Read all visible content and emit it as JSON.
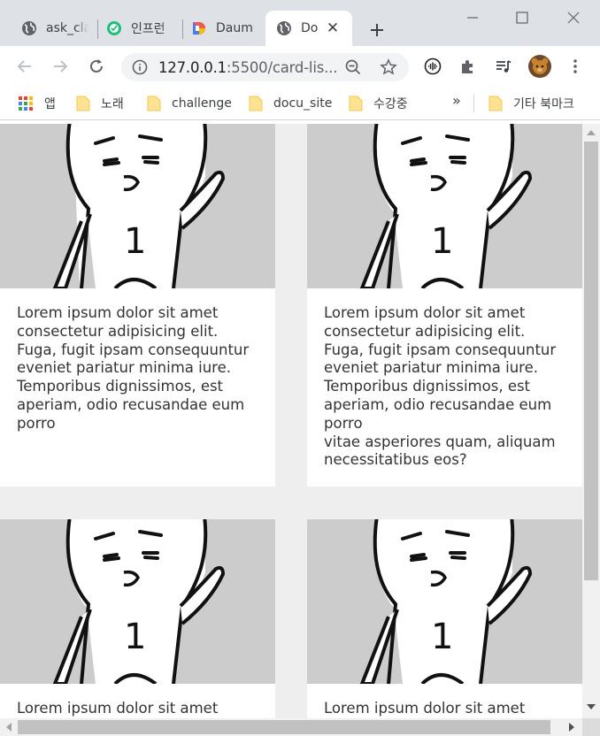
{
  "tabs": [
    {
      "title": "ask_class",
      "icon": "globe-icon",
      "active": false
    },
    {
      "title": "인프런",
      "icon": "inflearn-icon",
      "active": false
    },
    {
      "title": "Daum",
      "icon": "daum-icon",
      "active": false
    },
    {
      "title": "Document",
      "icon": "globe-icon",
      "active": true
    }
  ],
  "toolbar": {
    "url_host": "127.0.0.1",
    "url_rest": ":5500/card-lis..."
  },
  "bookmarks": {
    "apps_label": "앱",
    "items": [
      "노래",
      "challenge",
      "docu_site",
      "수강중"
    ],
    "more": "»",
    "other": "기타 북마크"
  },
  "cards": [
    {
      "illustration_text": "1",
      "text": "Lorem ipsum dolor sit amet consectetur adipisicing elit. Fuga, fugit ipsam consequuntur eveniet pariatur minima iure. Temporibus dignissimos, est aperiam, odio recusandae eum porro"
    },
    {
      "illustration_text": "1",
      "text": "Lorem ipsum dolor sit amet consectetur adipisicing elit. Fuga, fugit ipsam consequuntur eveniet pariatur minima iure. Temporibus dignissimos, est aperiam, odio recusandae eum porro\nvitae asperiores quam, aliquam necessitatibus eos?"
    },
    {
      "illustration_text": "1",
      "text": "Lorem ipsum dolor sit amet"
    },
    {
      "illustration_text": "1",
      "text": "Lorem ipsum dolor sit amet"
    }
  ],
  "colors": {
    "tabstrip": "#dee1e6",
    "page_background": "#eeeeee",
    "thumbnail_background": "#cccccc",
    "card_background": "#ffffff"
  }
}
